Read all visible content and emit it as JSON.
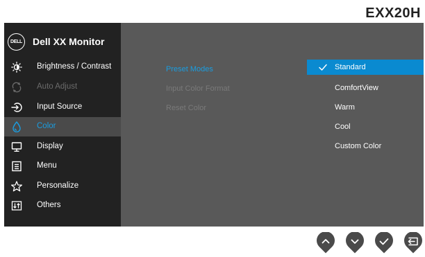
{
  "model": "EXX20H",
  "brand": {
    "logo_text": "DELL",
    "title": "Dell XX Monitor"
  },
  "sidebar": {
    "items": [
      {
        "label": "Brightness / Contrast",
        "icon": "brightness-icon",
        "state": "normal"
      },
      {
        "label": "Auto Adjust",
        "icon": "auto-adjust-icon",
        "state": "disabled"
      },
      {
        "label": "Input Source",
        "icon": "input-source-icon",
        "state": "normal"
      },
      {
        "label": "Color",
        "icon": "color-icon",
        "state": "active"
      },
      {
        "label": "Display",
        "icon": "display-icon",
        "state": "normal"
      },
      {
        "label": "Menu",
        "icon": "menu-icon",
        "state": "normal"
      },
      {
        "label": "Personalize",
        "icon": "star-icon",
        "state": "normal"
      },
      {
        "label": "Others",
        "icon": "others-icon",
        "state": "normal"
      }
    ]
  },
  "submenu": {
    "items": [
      {
        "label": "Preset Modes",
        "state": "selected"
      },
      {
        "label": "Input Color Format",
        "state": "dim"
      },
      {
        "label": "Reset Color",
        "state": "dim"
      }
    ]
  },
  "options": {
    "selected_index": 0,
    "items": [
      "Standard",
      "ComfortView",
      "Warm",
      "Cool",
      "Custom Color"
    ]
  },
  "buttons": [
    {
      "name": "up-button",
      "icon": "chevron-up-icon"
    },
    {
      "name": "down-button",
      "icon": "chevron-down-icon"
    },
    {
      "name": "ok-button",
      "icon": "check-icon"
    },
    {
      "name": "back-button",
      "icon": "back-icon"
    }
  ],
  "colors": {
    "accent": "#1a9de0",
    "selected_bg": "#0a8ad0",
    "panel": "#595959",
    "sidebar": "#222222",
    "button": "#4a4a4a"
  }
}
